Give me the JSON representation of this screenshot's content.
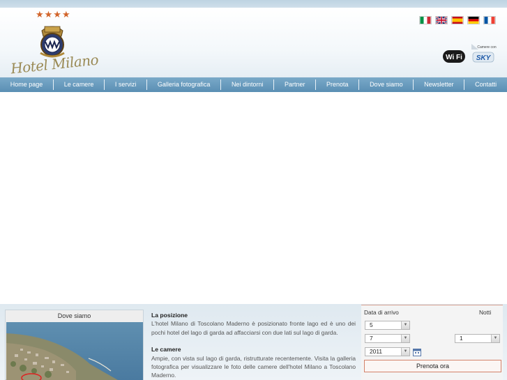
{
  "header": {
    "stars": "★★★★",
    "logo_text": "Hotel Milano",
    "flags": [
      {
        "name": "italian-flag-icon",
        "colors": [
          "#009246",
          "#ffffff",
          "#ce2b37"
        ]
      },
      {
        "name": "uk-flag-icon",
        "colors": [
          "#012169",
          "#ffffff",
          "#c8102e"
        ]
      },
      {
        "name": "spanish-flag-icon",
        "colors": [
          "#c60b1e",
          "#ffc400",
          "#c60b1e"
        ]
      },
      {
        "name": "german-flag-icon",
        "colors": [
          "#000000",
          "#dd0000",
          "#ffce00"
        ]
      },
      {
        "name": "french-flag-icon",
        "colors": [
          "#0055a4",
          "#ffffff",
          "#ef4135"
        ]
      }
    ],
    "wifi_label": "Wi Fi",
    "sky_label": "SKY",
    "sky_caption": "Camere con"
  },
  "nav": {
    "items": [
      "Home page",
      "Le camere",
      "I servizi",
      "Galleria fotografica",
      "Nei dintorni",
      "Partner",
      "Prenota",
      "Dove siamo",
      "Newsletter",
      "Contatti"
    ]
  },
  "map": {
    "title": "Dove siamo"
  },
  "content": {
    "sections": [
      {
        "title": "La posizione",
        "text": "L'hotel Milano di Toscolano Maderno è posizionato fronte lago ed è uno dei pochi hotel del lago di garda ad affacciarsi con due lati sul lago di garda."
      },
      {
        "title": "Le camere",
        "text": "Ampie, con vista sul lago di garda, ristrutturate recentemente. Visita la galleria fotografica per visualizzare le foto delle camere dell'hotel Milano a Toscolano Maderno."
      }
    ]
  },
  "booking": {
    "arrival_label": "Data di arrivo",
    "nights_label": "Notti",
    "day": "5",
    "month": "7",
    "year": "2011",
    "nights": "1",
    "button_label": "Prenota ora"
  },
  "colors": {
    "nav_bg": "#6a9cbe",
    "accent": "#d2642a",
    "booking_border": "#d3826a"
  }
}
